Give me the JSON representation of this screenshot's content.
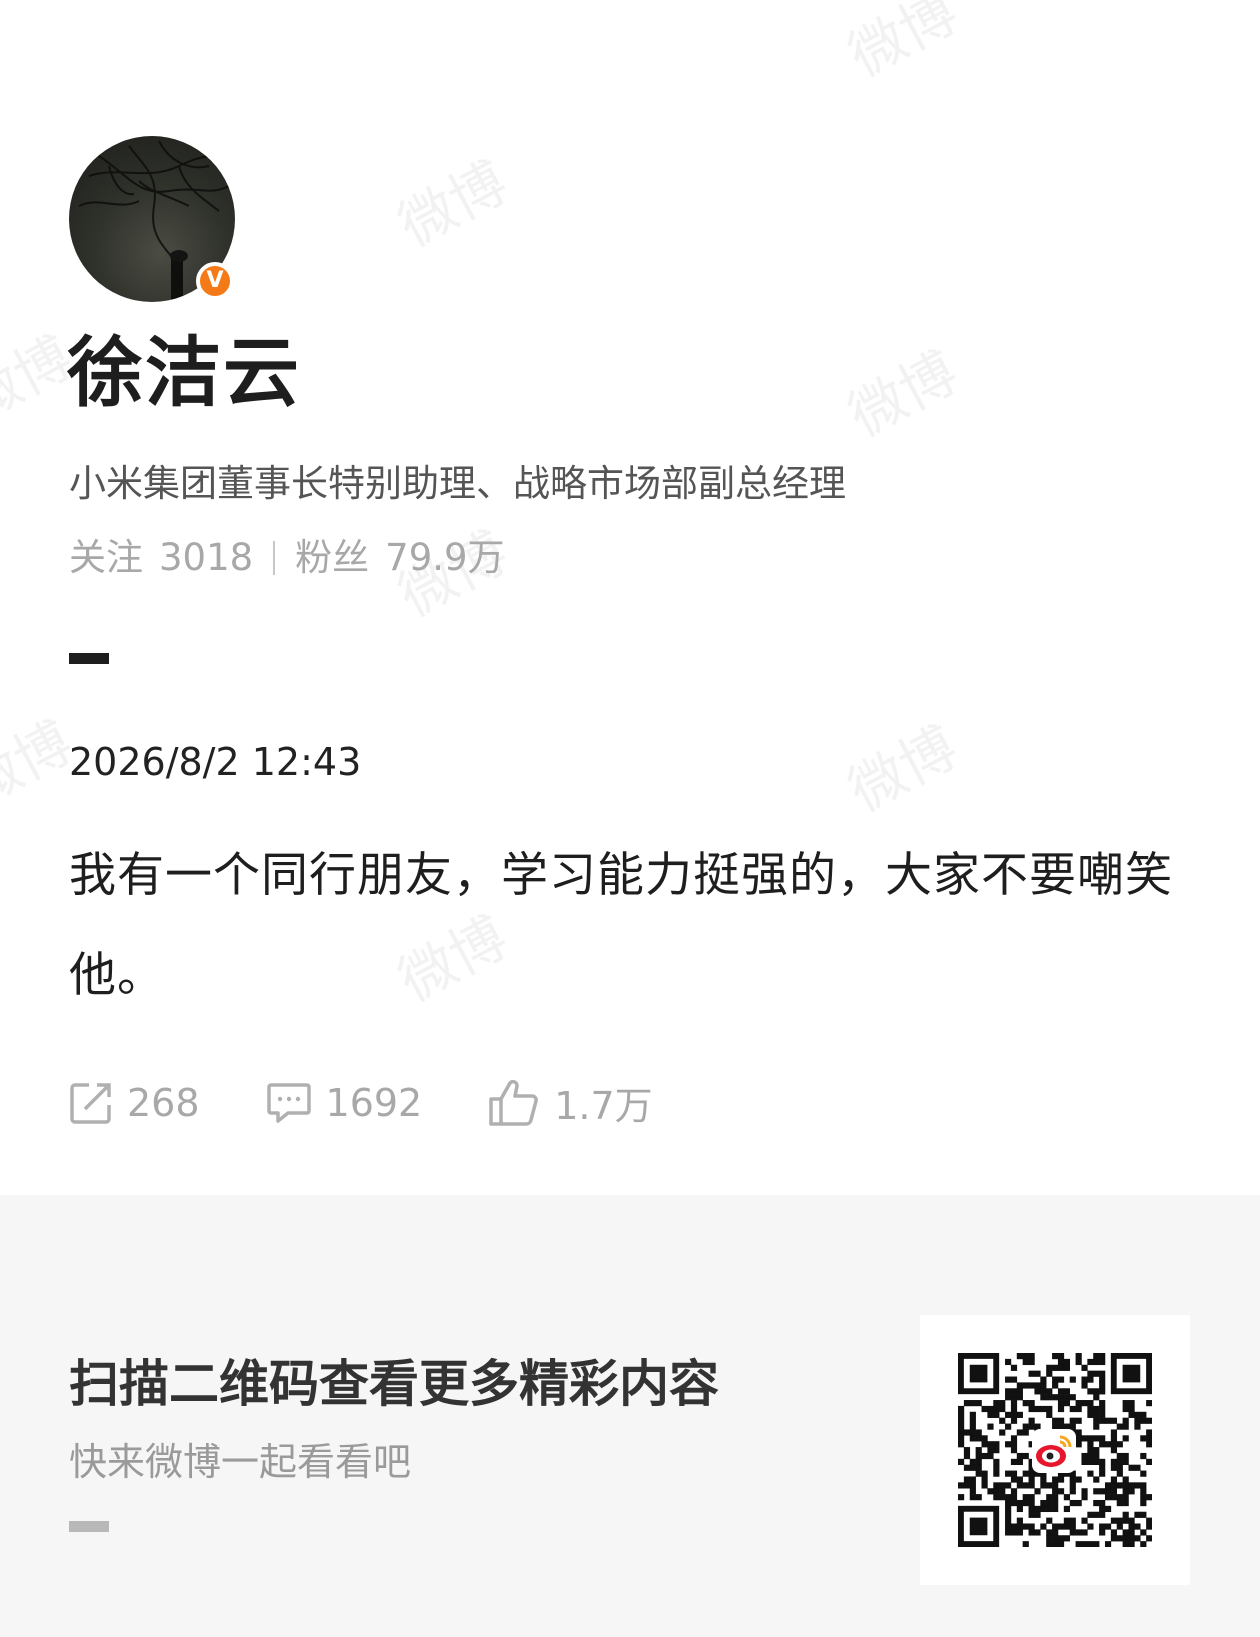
{
  "profile": {
    "name": "徐洁云",
    "verified_badge": "V",
    "bio": "小米集团董事长特别助理、战略市场部副总经理",
    "following_label": "关注",
    "following_count": "3018",
    "followers_label": "粉丝",
    "followers_count": "79.9万"
  },
  "post": {
    "timestamp": "2026/8/2 12:43",
    "text": "我有一个同行朋友，学习能力挺强的，大家不要嘲笑他。",
    "reposts": "268",
    "comments": "1692",
    "likes": "1.7万"
  },
  "footer": {
    "title": "扫描二维码查看更多精彩内容",
    "subtitle": "快来微博一起看看吧"
  },
  "watermark_text": "微博",
  "colors": {
    "verify_badge": "#f47a17",
    "muted_text": "#a8a8a8",
    "footer_bg": "#f6f6f6"
  },
  "icons": [
    "repost-icon",
    "comment-icon",
    "like-icon",
    "qr-code",
    "weibo-logo-icon"
  ]
}
